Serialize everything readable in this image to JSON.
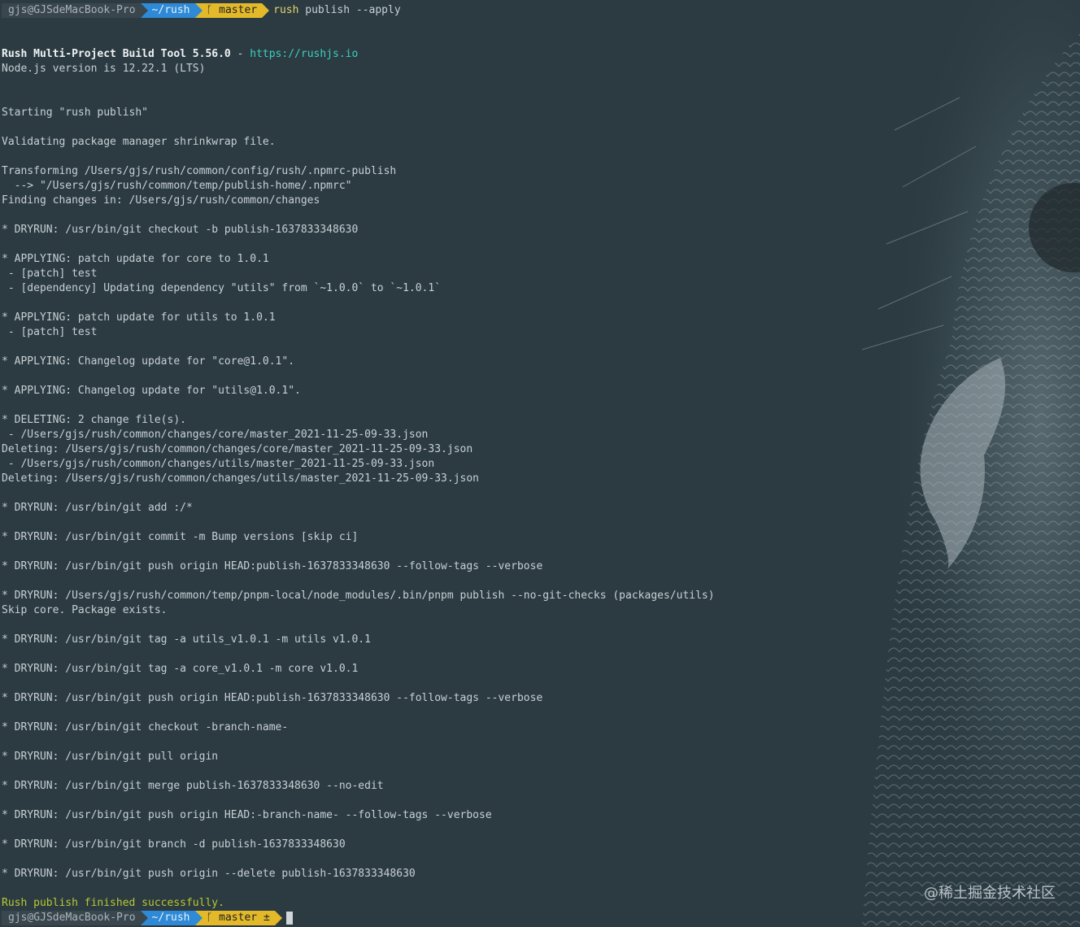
{
  "prompt_top": {
    "user_host": "gjs@GJSdeMacBook-Pro",
    "dir": "~/rush",
    "branch_icon": "git-branch-icon",
    "branch": "master",
    "command": "rush",
    "command_args": " publish --apply"
  },
  "header": {
    "tool_name": "Rush Multi-Project Build Tool 5.56.0",
    "dash": " - ",
    "url": "https://rushjs.io",
    "node_version": "Node.js version is 12.22.1 (LTS)"
  },
  "output_lines": [
    "",
    "",
    "Starting \"rush publish\"",
    "",
    "Validating package manager shrinkwrap file.",
    "",
    "Transforming /Users/gjs/rush/common/config/rush/.npmrc-publish",
    "  --> \"/Users/gjs/rush/common/temp/publish-home/.npmrc\"",
    "Finding changes in: /Users/gjs/rush/common/changes",
    "",
    "* DRYRUN: /usr/bin/git checkout -b publish-1637833348630",
    "",
    "* APPLYING: patch update for core to 1.0.1",
    " - [patch] test",
    " - [dependency] Updating dependency \"utils\" from `~1.0.0` to `~1.0.1`",
    "",
    "* APPLYING: patch update for utils to 1.0.1",
    " - [patch] test",
    "",
    "* APPLYING: Changelog update for \"core@1.0.1\".",
    "",
    "* APPLYING: Changelog update for \"utils@1.0.1\".",
    "",
    "* DELETING: 2 change file(s).",
    " - /Users/gjs/rush/common/changes/core/master_2021-11-25-09-33.json",
    "Deleting: /Users/gjs/rush/common/changes/core/master_2021-11-25-09-33.json",
    " - /Users/gjs/rush/common/changes/utils/master_2021-11-25-09-33.json",
    "Deleting: /Users/gjs/rush/common/changes/utils/master_2021-11-25-09-33.json",
    "",
    "* DRYRUN: /usr/bin/git add :/*",
    "",
    "* DRYRUN: /usr/bin/git commit -m Bump versions [skip ci]",
    "",
    "* DRYRUN: /usr/bin/git push origin HEAD:publish-1637833348630 --follow-tags --verbose",
    "",
    "* DRYRUN: /Users/gjs/rush/common/temp/pnpm-local/node_modules/.bin/pnpm publish --no-git-checks (packages/utils)",
    "Skip core. Package exists.",
    "",
    "* DRYRUN: /usr/bin/git tag -a utils_v1.0.1 -m utils v1.0.1",
    "",
    "* DRYRUN: /usr/bin/git tag -a core_v1.0.1 -m core v1.0.1",
    "",
    "* DRYRUN: /usr/bin/git push origin HEAD:publish-1637833348630 --follow-tags --verbose",
    "",
    "* DRYRUN: /usr/bin/git checkout -branch-name-",
    "",
    "* DRYRUN: /usr/bin/git pull origin",
    "",
    "* DRYRUN: /usr/bin/git merge publish-1637833348630 --no-edit",
    "",
    "* DRYRUN: /usr/bin/git push origin HEAD:-branch-name- --follow-tags --verbose",
    "",
    "* DRYRUN: /usr/bin/git branch -d publish-1637833348630",
    "",
    "* DRYRUN: /usr/bin/git push origin --delete publish-1637833348630",
    ""
  ],
  "success_message": "Rush publish finished successfully.",
  "prompt_bottom": {
    "user_host": "gjs@GJSdeMacBook-Pro",
    "dir": "~/rush",
    "branch": "master ±"
  },
  "watermark": "@稀土掘金技术社区",
  "colors": {
    "background": "#2c3b42",
    "text": "#c7d0d4",
    "url": "#3ccfc0",
    "success": "#b8c832",
    "prompt_dir": "#2e8ad6",
    "prompt_git": "#e3b92a"
  }
}
